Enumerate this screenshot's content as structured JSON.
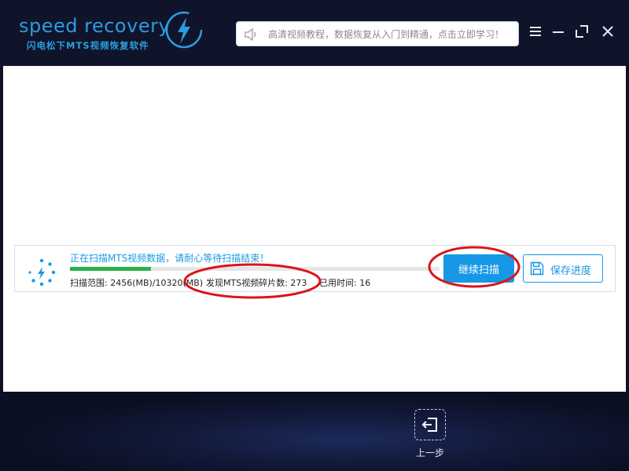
{
  "app": {
    "logo_text": "speed recovery",
    "logo_subtitle": "闪电松下MTS视频恢复软件",
    "notice": "高清视频教程，数据恢复从入门到精通，点击立即学习！",
    "brand_color": "#2a9de0"
  },
  "window_controls": {
    "menu_icon": "hamburger-icon",
    "minimize_icon": "minimize-icon",
    "maximize_icon": "maximize-icon",
    "close_icon": "close-icon"
  },
  "scan": {
    "status": "正在扫描MTS视频数据，请耐心等待扫描结束！",
    "progress": 0.22,
    "range_label": "扫描范围: 2456(MB)/10320(MB)",
    "fragments_label": "发现MTS视频碎片数: 273",
    "elapsed_label": "已用时间: 16",
    "continue_button": "继续扫描",
    "save_button": "保存进度",
    "progress_color": "#2ab34a",
    "accent_color": "#1798e6"
  },
  "footer": {
    "back_label": "上一步"
  }
}
